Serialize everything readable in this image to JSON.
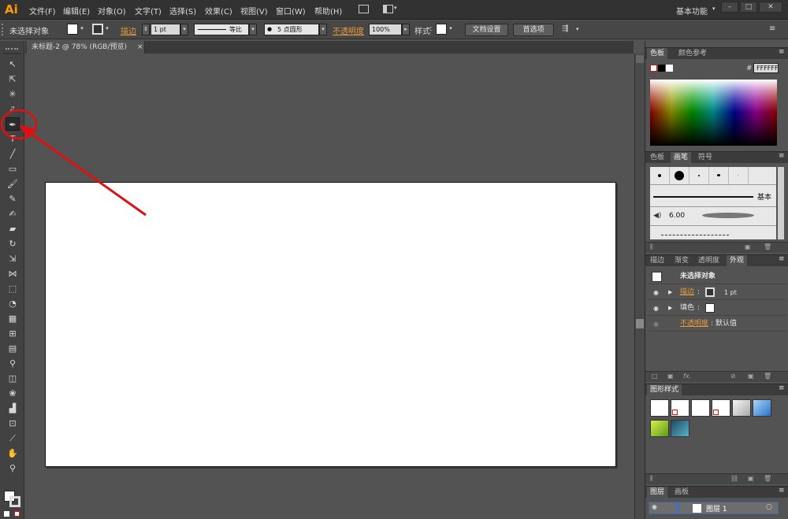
{
  "app": {
    "logo": "Ai",
    "accent": "#ff9a00"
  },
  "menu": {
    "items": [
      "文件(F)",
      "编辑(E)",
      "对象(O)",
      "文字(T)",
      "选择(S)",
      "效果(C)",
      "视图(V)",
      "窗口(W)",
      "帮助(H)"
    ],
    "workspace": "基本功能",
    "window_buttons": [
      "–",
      "□",
      "✕"
    ]
  },
  "control_bar": {
    "selection_label": "未选择对象",
    "stroke_label": "描边",
    "stroke_weight": "1 pt",
    "stroke_profile": "等比",
    "brush": "5 点圆形",
    "opacity_label": "不透明度",
    "opacity_value": "100%",
    "style_label": "样式",
    "doc_setup_button": "文档设置",
    "prefs_button": "首选项"
  },
  "document": {
    "tab_title": "未标题-2 @ 78% (RGB/预览)",
    "tab_close": "×"
  },
  "tools": [
    "selection-tool",
    "direct-selection-tool",
    "magic-wand-tool",
    "lasso-tool",
    "pen-tool",
    "type-tool",
    "line-tool",
    "rectangle-tool",
    "paintbrush-tool",
    "pencil-tool",
    "blob-brush-tool",
    "eraser-tool",
    "rotate-tool",
    "scale-tool",
    "width-tool",
    "free-transform-tool",
    "shape-builder-tool",
    "perspective-grid-tool",
    "mesh-tool",
    "gradient-tool",
    "eyedropper-tool",
    "blend-tool",
    "symbol-sprayer-tool",
    "column-graph-tool",
    "artboard-tool",
    "slice-tool",
    "hand-tool",
    "zoom-tool"
  ],
  "swatches_panel": {
    "tabs": [
      "色板",
      "颜色参考"
    ],
    "hex_label": "#",
    "hex_value": "FFFFFF"
  },
  "brushes_panel": {
    "tabs": [
      "色板",
      "画笔",
      "符号"
    ],
    "basic_label": "基本",
    "size_value": "6.00"
  },
  "appearance_panel": {
    "tabs": [
      "描边",
      "渐变",
      "透明度",
      "外观"
    ],
    "header": "未选择对象",
    "stroke_label": "描边",
    "stroke_value": "1 pt",
    "fill_label": "填色",
    "opacity_label": "不透明度",
    "opacity_value": "默认值",
    "colon": ":"
  },
  "graphic_styles_panel": {
    "tabs": [
      "图形样式"
    ]
  },
  "layers_panel": {
    "tabs": [
      "图层",
      "画板"
    ],
    "layer_name": "图层 1"
  },
  "annotation": {
    "color": "#e01010"
  }
}
